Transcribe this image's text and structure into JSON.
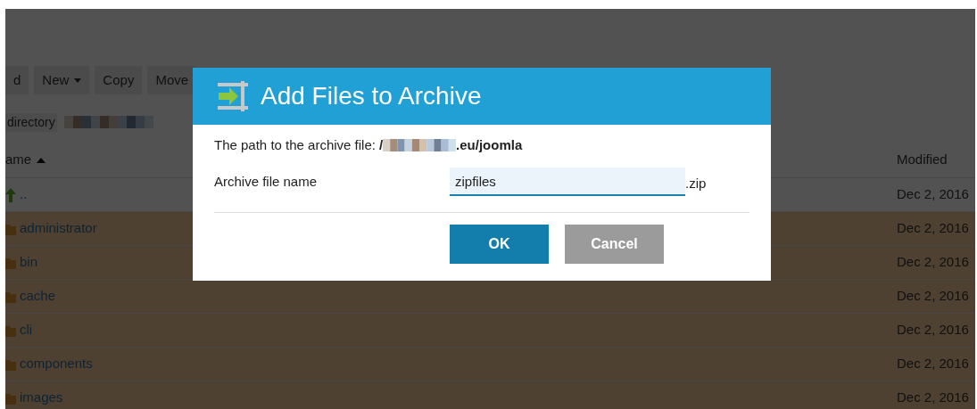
{
  "toolbar": {
    "buttons": [
      {
        "label": "d",
        "kind": "plain"
      },
      {
        "label": "New",
        "kind": "dropdown"
      },
      {
        "label": "Copy",
        "kind": "plain"
      },
      {
        "label": "Move",
        "kind": "plain"
      }
    ]
  },
  "breadcrumb": {
    "label": "directory"
  },
  "table": {
    "columns": [
      {
        "label": "ame",
        "sorted": true
      },
      {
        "label": "Modified",
        "sorted": false
      }
    ],
    "rows": [
      {
        "name": "..",
        "kind": "parent",
        "modified": "Dec 2, 2016",
        "selected": false
      },
      {
        "name": "administrator",
        "kind": "folder",
        "modified": "Dec 2, 2016",
        "selected": true
      },
      {
        "name": "bin",
        "kind": "folder",
        "modified": "Dec 2, 2016",
        "selected": true
      },
      {
        "name": "cache",
        "kind": "folder",
        "modified": "Dec 2, 2016",
        "selected": true
      },
      {
        "name": "cli",
        "kind": "folder",
        "modified": "Dec 2, 2016",
        "selected": true
      },
      {
        "name": "components",
        "kind": "folder",
        "modified": "Dec 2, 2016",
        "selected": true
      },
      {
        "name": "images",
        "kind": "folder",
        "modified": "Dec 2, 2016",
        "selected": true
      }
    ]
  },
  "dialog": {
    "title": "Add Files to Archive",
    "path_label": "The path to the archive file:",
    "path_start": "/",
    "path_end": ".eu/joomla",
    "field_label": "Archive file name",
    "field_value": "zipfiles",
    "field_suffix": ".zip",
    "buttons": [
      {
        "label": "OK",
        "kind": "primary"
      },
      {
        "label": "Cancel",
        "kind": "secondary"
      }
    ]
  }
}
